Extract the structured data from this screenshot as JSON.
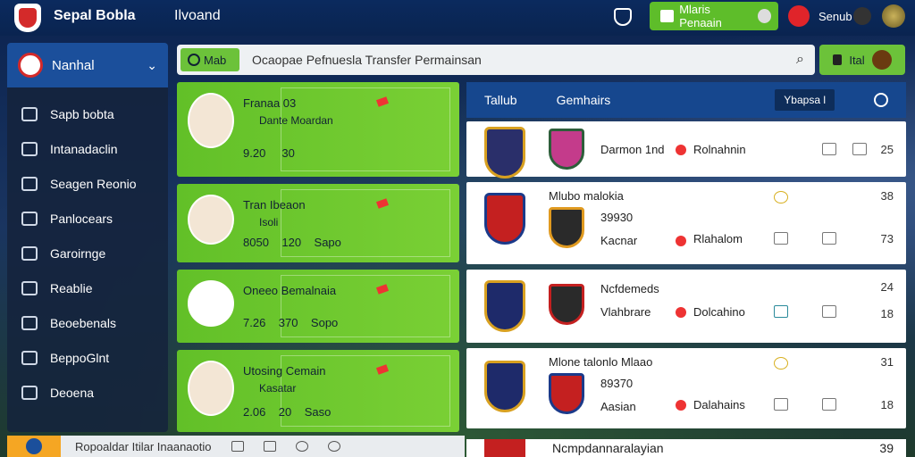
{
  "header": {
    "app_title": "Sepal Bobla",
    "nav_home": "Ilvoand",
    "promo_label": "Mlaris Penaain",
    "user_name": "Senub"
  },
  "sidebar": {
    "head_label": "Nanhal",
    "items": [
      {
        "label": "Sapb bobta",
        "icon": "badge-icon"
      },
      {
        "label": "Intanadaclin",
        "icon": "chat-icon"
      },
      {
        "label": "Seagen Reonio",
        "icon": "chat-bubble-icon"
      },
      {
        "label": "Panlocears",
        "icon": "send-icon"
      },
      {
        "label": "Garoirnge",
        "icon": "coin-icon"
      },
      {
        "label": "Reablie",
        "icon": "people-icon"
      },
      {
        "label": "Beoebenals",
        "icon": "chat-icon"
      },
      {
        "label": "BeppoGlnt",
        "icon": "chart-icon"
      },
      {
        "label": "Deoena",
        "icon": "menu-icon"
      }
    ]
  },
  "search": {
    "filter_label": "Mab",
    "text": "Ocaopae  Pefnuesla  Transfer Permainsan",
    "side_label": "Ital"
  },
  "players": [
    {
      "name": "Franaa 03",
      "sub": "Dante Moardan",
      "stat1": "9.20",
      "stat2": "30"
    },
    {
      "name": "Tran Ibeaon",
      "sub": "Isoli",
      "stat1": "8050",
      "stat2": "120",
      "stat3": "Sapo"
    },
    {
      "name": "Oneeo Bemalnaia",
      "sub": "",
      "stat1": "7.26",
      "stat2": "370",
      "stat3": "Sopo"
    },
    {
      "name": "Utosing Cemain",
      "sub": "Kasatar",
      "stat1": "2.06",
      "stat2": "20",
      "stat3": "Saso"
    }
  ],
  "clubs": {
    "head_left": "Tallub",
    "head_mid": "Gemhairs",
    "head_tag": "Ybapsa l",
    "rows": [
      {
        "title": "",
        "name": "Darmon 1nd",
        "club": "Rolnahnin",
        "value": "",
        "num": "25"
      },
      {
        "title": "Mlubo malokia",
        "name": "Kacnar",
        "club": "Rlahalom",
        "value": "39930",
        "num": "73",
        "top": "38"
      },
      {
        "title": "Ncfdemeds",
        "name": "Vlahbrare",
        "club": "Dolcahino",
        "value": "",
        "num": "18",
        "top": "24"
      },
      {
        "title": "Mlone talonlo Mlaao",
        "name": "Aasian",
        "club": "Dalahains",
        "value": "89370",
        "num": "18",
        "top": "31"
      }
    ],
    "bottom_title": "Ncmpdannaralayian",
    "bottom_num": "39"
  },
  "footer": {
    "text": "Ropoaldar  Itilar  Inaanaotio"
  },
  "colors": {
    "accent_green": "#6cc23a",
    "brand_blue": "#1b4f9b",
    "alert_red": "#e0242a"
  }
}
